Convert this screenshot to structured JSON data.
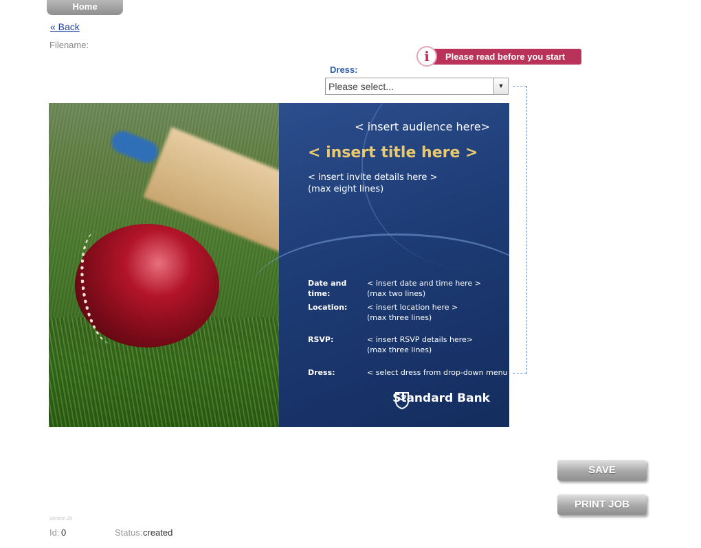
{
  "nav": {
    "home_label": "Home",
    "back_label": "« Back"
  },
  "file": {
    "filename_label": "Filename:"
  },
  "notice": {
    "icon_glyph": "i",
    "label": "Please read before you start"
  },
  "dress": {
    "label": "Dress:",
    "placeholder": "Please select...",
    "arrow": "▼"
  },
  "invitation": {
    "audience": "< insert audience here>",
    "title": "< insert title here >",
    "details_line1": "< insert invite details here >",
    "details_line2": "(max eight lines)",
    "rows": [
      {
        "label": "Date and time:",
        "value_line1": "< insert date and time here >",
        "value_line2": "(max two lines)"
      },
      {
        "label": "Location:",
        "value_line1": "< insert location here >",
        "value_line2": "(max three lines)"
      },
      {
        "label": "RSVP:",
        "value_line1": "< insert RSVP details here>",
        "value_line2": "(max three lines)"
      },
      {
        "label": "Dress:",
        "value_line1": "< select dress from drop-down menu >",
        "value_line2": ""
      }
    ],
    "brand": "Standard Bank"
  },
  "actions": {
    "save_label": "SAVE",
    "print_label": "PRINT JOB"
  },
  "footer": {
    "version": "Version 28",
    "id_label": "Id:",
    "id_value": "0",
    "status_label": "Status:",
    "status_value": "created"
  },
  "colors": {
    "notice_bg": "#b8325a",
    "link": "#1a3d9c",
    "dress_label": "#2a5bb0",
    "card_bg": "#1d3b75",
    "title_gold": "#e9c96b"
  }
}
